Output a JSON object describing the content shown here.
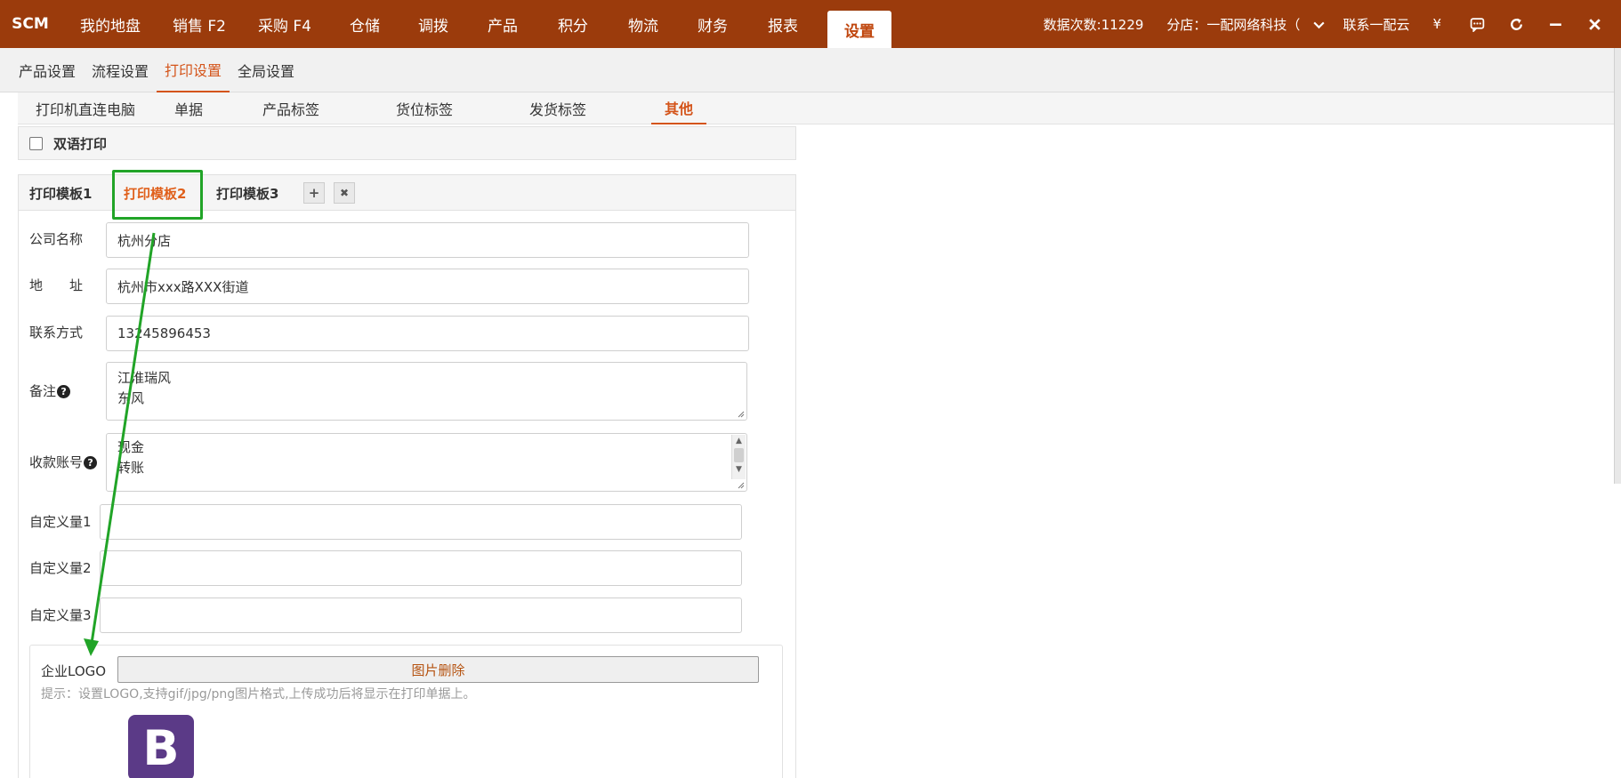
{
  "topbar": {
    "brand": "SCM",
    "nav": [
      "我的地盘",
      "销售 F2",
      "采购 F4",
      "仓储",
      "调拨",
      "产品",
      "积分",
      "物流",
      "财务",
      "报表",
      "设置"
    ],
    "data_count": "数据次数:11229",
    "branch": "分店：一配网络科技（",
    "contact": "联系一配云",
    "yuan": "¥"
  },
  "subnav": [
    "产品设置",
    "流程设置",
    "打印设置",
    "全局设置"
  ],
  "thirdnav": [
    "打印机直连电脑",
    "单据",
    "产品标签",
    "货位标签",
    "发货标签",
    "其他"
  ],
  "bilingual": {
    "label": "双语打印"
  },
  "templates": {
    "tabs": [
      "打印模板1",
      "打印模板2",
      "打印模板3"
    ],
    "add": "+",
    "remove": "✖"
  },
  "form": {
    "company_label": "公司名称",
    "company_value": "杭州分店",
    "address_label": "地　　址",
    "address_value": "杭州市xxx路XXX街道",
    "contact_label": "联系方式",
    "contact_value": "13245896453",
    "remark_label": "备注",
    "remark_lines": [
      "江淮瑞风",
      "东风"
    ],
    "account_label": "收款账号",
    "account_lines": [
      "现金",
      "转账"
    ],
    "custom1_label": "自定义量1",
    "custom2_label": "自定义量2",
    "custom3_label": "自定义量3",
    "help": "?"
  },
  "logo": {
    "label": "企业LOGO",
    "delete_button": "图片删除",
    "hint": "提示：设置LOGO,支持gif/jpg/png图片格式,上传成功后将显示在打印单据上。",
    "letter": "B"
  },
  "colors": {
    "header": "#9b3b0c",
    "accent": "#d4541a",
    "highlight": "#21a427"
  }
}
